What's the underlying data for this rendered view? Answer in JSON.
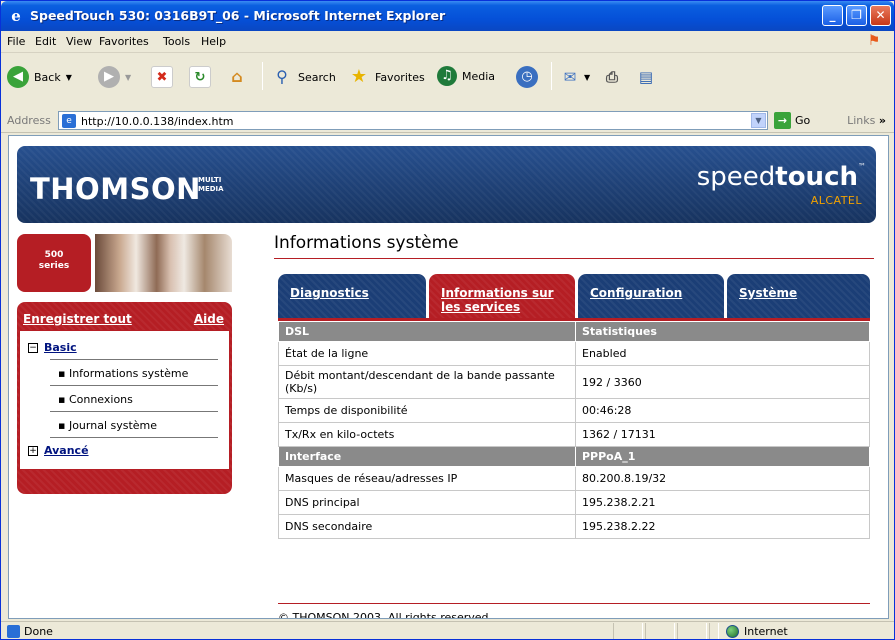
{
  "window": {
    "title": "SpeedTouch 530:  0316B9T_06 - Microsoft Internet Explorer"
  },
  "menu": [
    "File",
    "Edit",
    "View",
    "Favorites",
    "Tools",
    "Help"
  ],
  "toolbar": {
    "back": "Back",
    "search": "Search",
    "favorites": "Favorites",
    "media": "Media"
  },
  "address": {
    "label": "Address",
    "url": "http://10.0.0.138/index.htm",
    "go": "Go",
    "links": "Links"
  },
  "banner": {
    "brand": "THOMSON",
    "brand_sub": "MULTI MEDIA",
    "product_thin": "speed",
    "product_bold": "touch",
    "tm": "™",
    "maker": "ALCATEL"
  },
  "series": {
    "line1": "500",
    "line2": "series"
  },
  "nav": {
    "save_all": "Enregistrer tout",
    "help": "Aide",
    "basic": {
      "symbol": "−",
      "label": "Basic"
    },
    "items": [
      "Informations système",
      "Connexions",
      "Journal système"
    ],
    "advanced": {
      "symbol": "+",
      "label": "Avancé"
    }
  },
  "page": {
    "title": "Informations système"
  },
  "tabs": [
    {
      "label": "Diagnostics"
    },
    {
      "label": "Informations sur les services"
    },
    {
      "label": "Configuration"
    },
    {
      "label": "Système"
    }
  ],
  "table": {
    "dsl_header": [
      "DSL",
      "Statistiques"
    ],
    "dsl_rows": [
      [
        "État de la ligne",
        "Enabled"
      ],
      [
        "Débit montant/descendant de la bande passante (Kb/s)",
        "192 / 3360"
      ],
      [
        "Temps de disponibilité",
        "00:46:28"
      ],
      [
        "Tx/Rx en kilo-octets",
        "1362 / 17131"
      ]
    ],
    "iface_header": [
      "Interface",
      "PPPoA_1"
    ],
    "iface_rows": [
      [
        "Masques de réseau/adresses IP",
        "80.200.8.19/32"
      ],
      [
        "DNS principal",
        "195.238.2.21"
      ],
      [
        "DNS secondaire",
        "195.238.2.22"
      ]
    ]
  },
  "footer": {
    "copyright": "© THOMSON 2003. All rights reserved."
  },
  "status": {
    "left": "Done",
    "zone": "Internet"
  },
  "colors": {
    "thomson_blue": "#1b3e76",
    "thomson_red": "#b51e24",
    "alcatel_orange": "#f2a200"
  }
}
